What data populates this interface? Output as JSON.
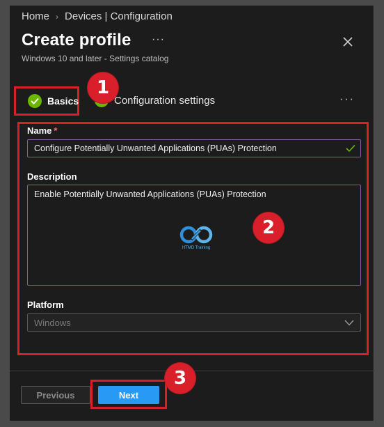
{
  "breadcrumb": {
    "items": [
      "Home",
      "Devices | Configuration"
    ],
    "separator": "›"
  },
  "header": {
    "title": "Create profile",
    "more": "···",
    "subtitle": "Windows 10 and later - Settings catalog"
  },
  "tabs": [
    {
      "label": "Basics",
      "state": "completed",
      "icon": "check-circle-icon"
    },
    {
      "label": "Configuration settings",
      "state": "completed",
      "icon": "status-dot-icon"
    }
  ],
  "tabs_more": "···",
  "form": {
    "name_label": "Name",
    "name_required": "*",
    "name_value": "Configure Potentially Unwanted Applications (PUAs) Protection",
    "description_label": "Description",
    "description_value": "Enable Potentially Unwanted Applications (PUAs) Protection",
    "platform_label": "Platform",
    "platform_value": "Windows"
  },
  "watermark": {
    "text": "HTMD Training",
    "icon": "htmd-logo-icon"
  },
  "callouts": [
    "1",
    "2",
    "3"
  ],
  "footer": {
    "previous_label": "Previous",
    "next_label": "Next"
  },
  "colors": {
    "accent": "#2899f5",
    "success": "#6bb700",
    "annotation": "#d9202a",
    "input_focus": "#8a5ea8"
  }
}
